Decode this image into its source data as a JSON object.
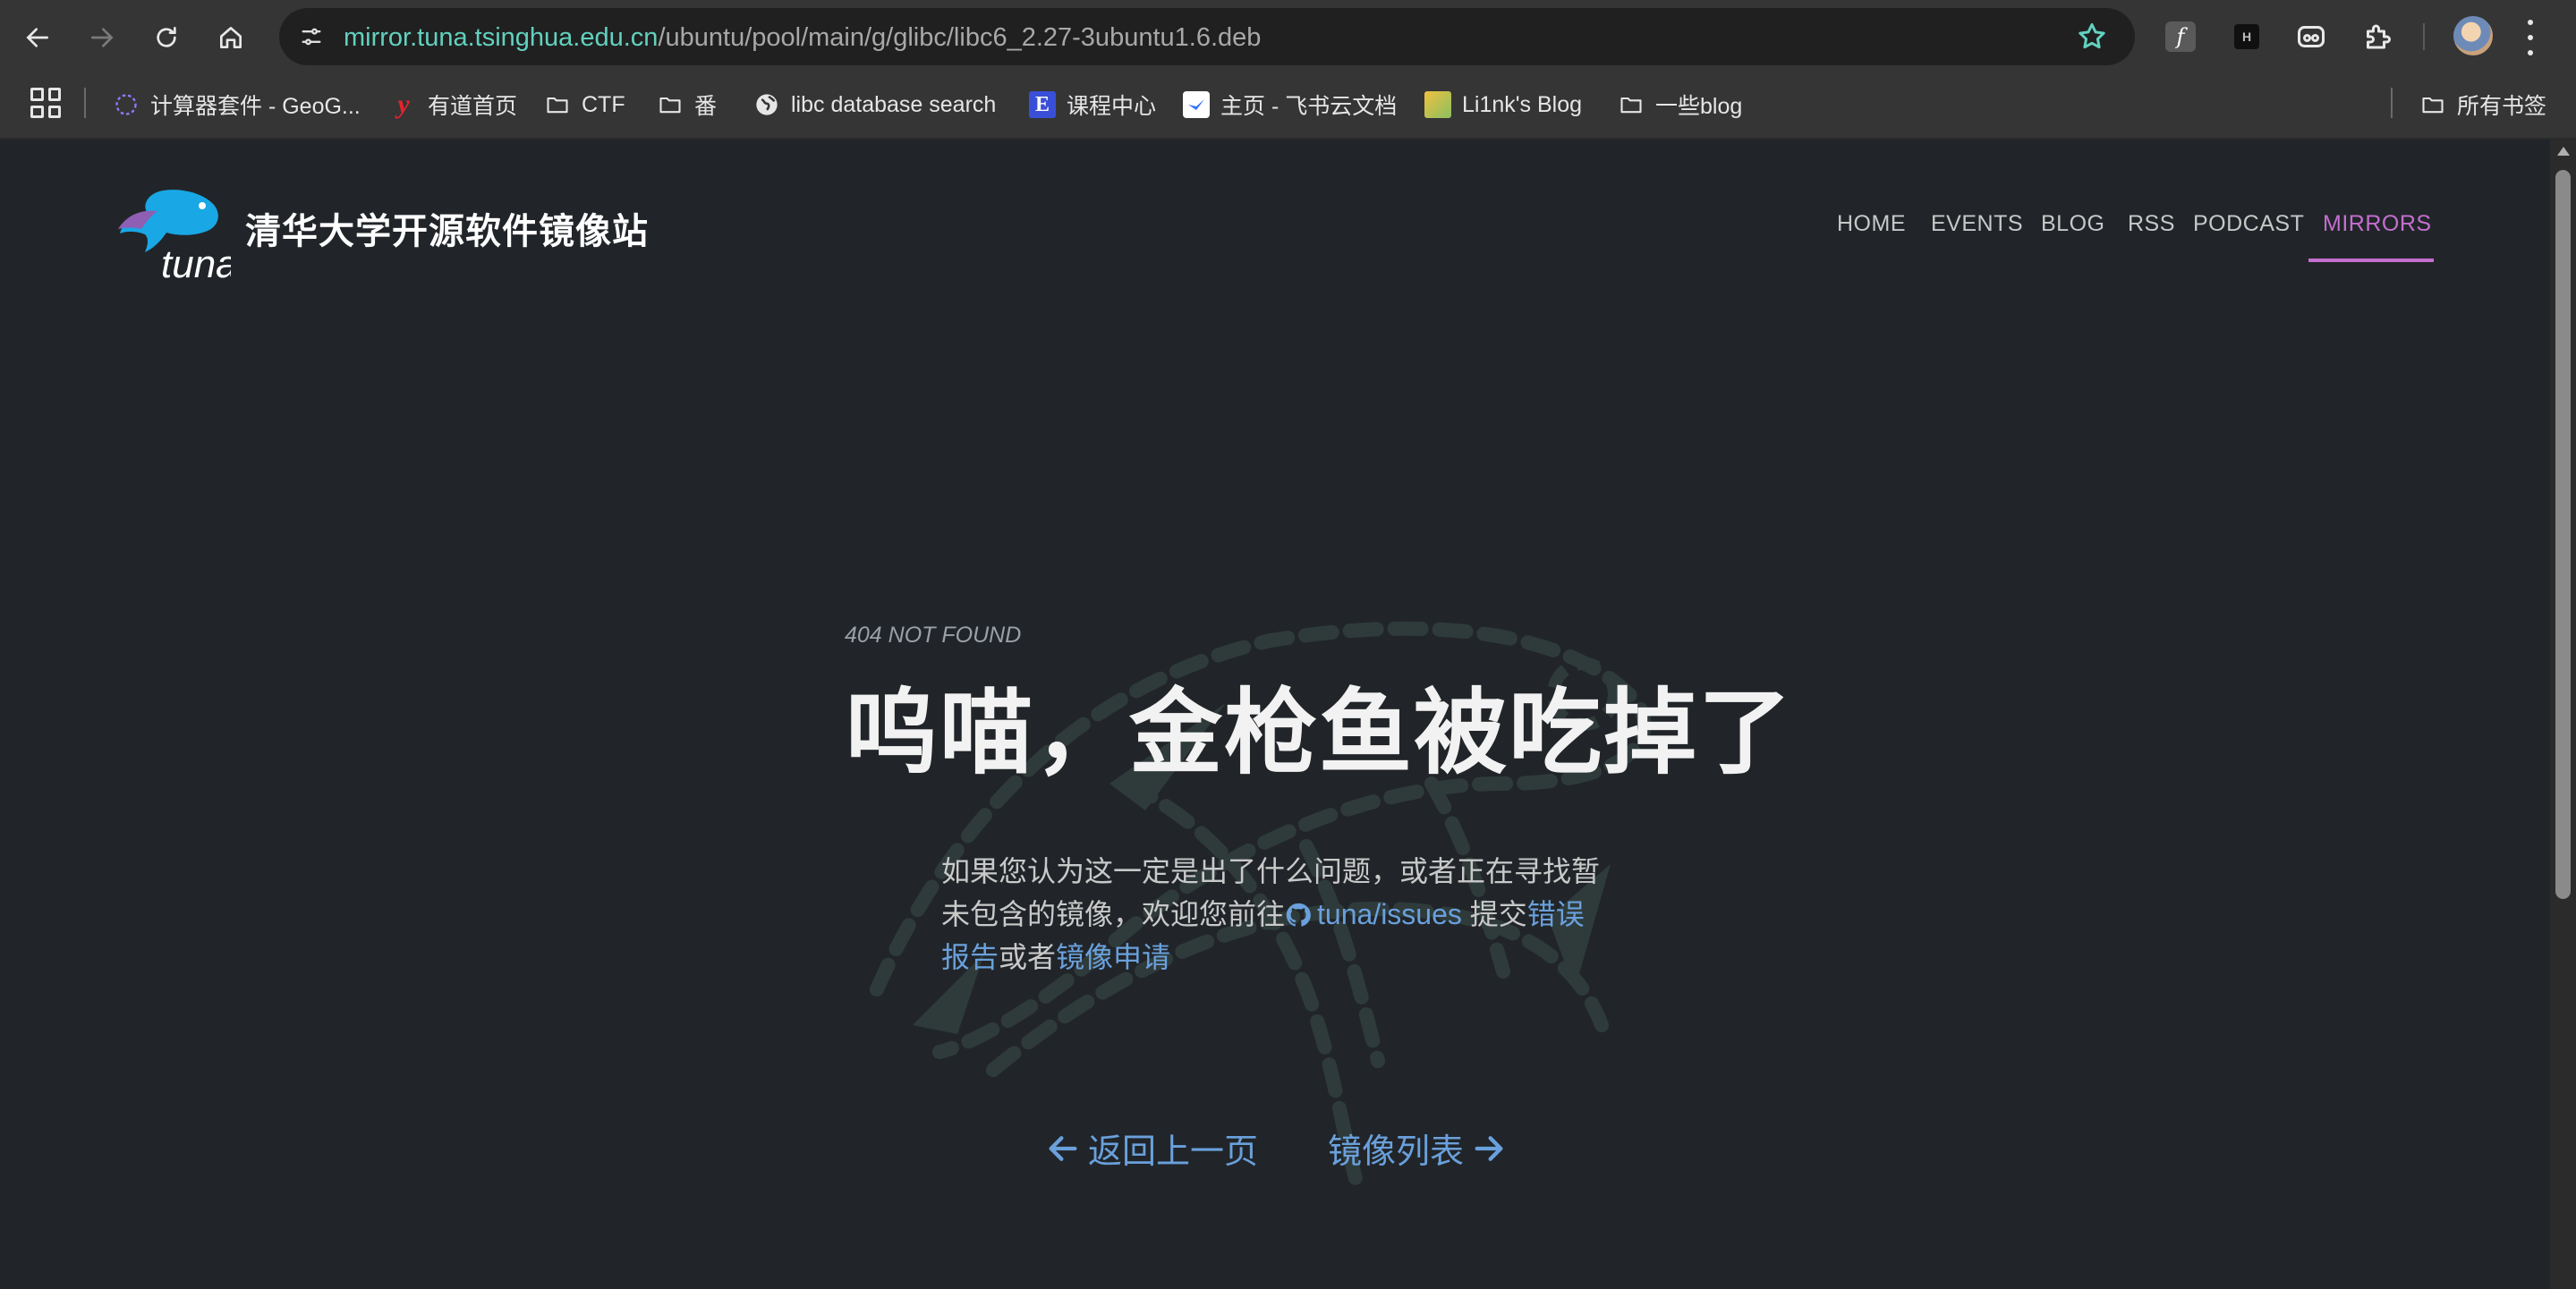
{
  "browser": {
    "url_host": "mirror.tuna.tsinghua.edu.cn",
    "url_path": "/ubuntu/pool/main/g/glibc/libc6_2.27-3ubuntu1.6.deb",
    "bookmarks": [
      {
        "label": "计算器套件 - GeoG...",
        "icon": "geogebra-icon"
      },
      {
        "label": "有道首页",
        "icon": "youdao-icon"
      },
      {
        "label": "CTF",
        "icon": "folder-icon"
      },
      {
        "label": "番",
        "icon": "folder-icon"
      },
      {
        "label": "libc database search",
        "icon": "globe-icon"
      },
      {
        "label": "课程中心",
        "icon": "course-icon"
      },
      {
        "label": "主页 - 飞书云文档",
        "icon": "feishu-icon"
      },
      {
        "label": "Li1nk's Blog",
        "icon": "blog-icon"
      },
      {
        "label": "一些blog",
        "icon": "folder-icon"
      }
    ],
    "all_bookmarks": "所有书签",
    "ext_f_letter": "f",
    "ext_h_letter": "H"
  },
  "site": {
    "title": "清华大学开源软件镜像站",
    "logo_text": "tuna",
    "nav": [
      "HOME",
      "EVENTS",
      "BLOG",
      "RSS",
      "PODCAST",
      "MIRRORS"
    ],
    "active_nav": "MIRRORS",
    "accent": "#c46ed0"
  },
  "error": {
    "code_label": "404 NOT FOUND",
    "headline": "呜喵，金枪鱼被吃掉了",
    "desc_prefix": "如果您认为这一定是出了什么问题，或者正在寻找暂未包含的镜像，欢迎您前往",
    "issues_link": "tuna/issues",
    "desc_mid": "提交",
    "bug_report_link": "错误报告",
    "desc_or": "或者",
    "mirror_request_link": "镜像申请",
    "back_label": "返回上一页",
    "mirror_list_label": "镜像列表",
    "link_color": "#6aa0dc"
  }
}
